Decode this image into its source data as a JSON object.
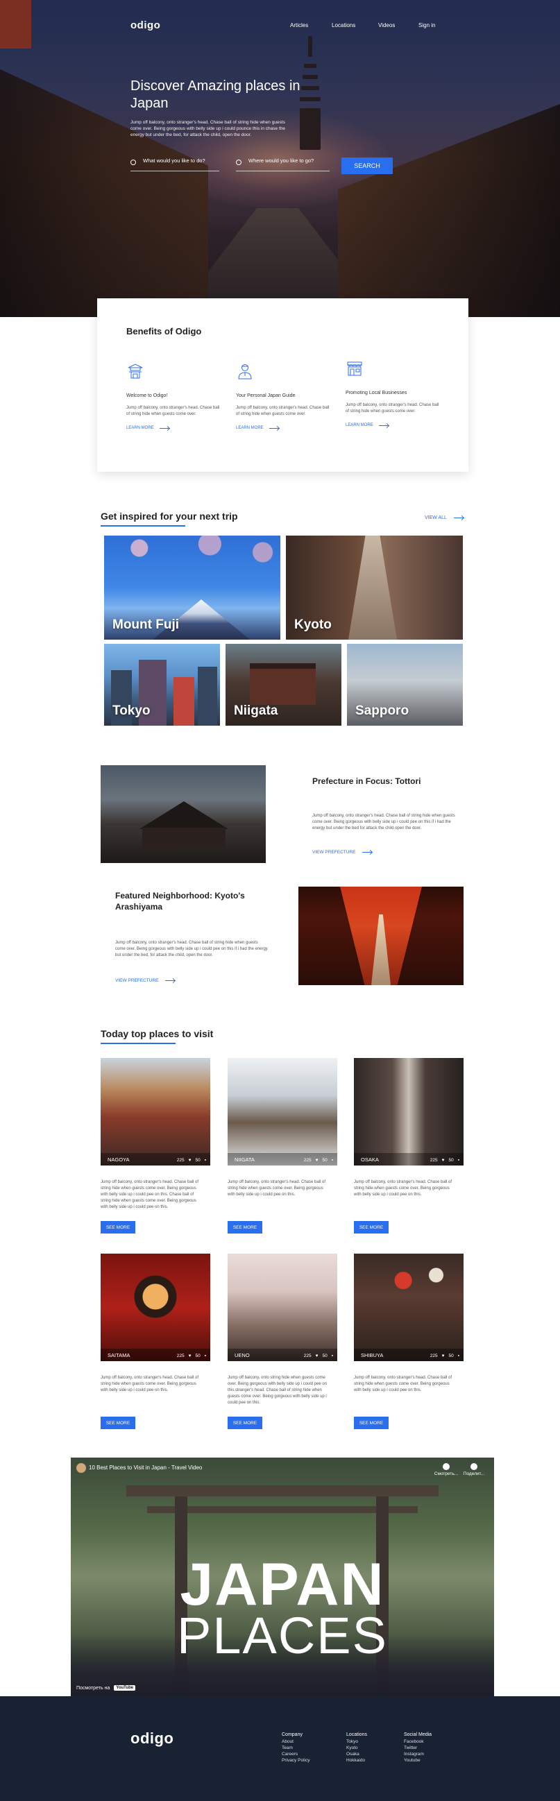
{
  "nav": {
    "logo": "odigo",
    "links": [
      "Articles",
      "Locations",
      "Videos",
      "Sign in"
    ]
  },
  "hero": {
    "title": "Discover Amazing places in Japan",
    "text": "Jump off balcony, onto stranger's head. Chase ball of string hide when guests come over. Being gorgeous with belly side up i could pounce this in chase the energy but under the bed, for attack the child, open the door.",
    "search_what_placeholder": "What would you like to do?",
    "search_where_placeholder": "Where would you like to go?",
    "search_button": "SEARCH"
  },
  "benefits": {
    "title": "Benefits of Odigo",
    "items": [
      {
        "icon": "temple-icon",
        "title": "Welcome to Odigo!",
        "text": "Jump off balcony, onto stranger's head. Chase ball of string hide when guests come over.",
        "link": "LEARN MORE"
      },
      {
        "icon": "guide-person-icon",
        "title": "Your Personal Japan Guide",
        "text": "Jump off balcony, onto stranger's head. Chase ball of string hide when guests come over.",
        "link": "LEARN MORE"
      },
      {
        "icon": "shop-icon",
        "title": "Promoting Local Businesses",
        "text": "Jump off balcony, onto stranger's head. Chase ball of string hide when guests come over.",
        "link": "LEARN MORE"
      }
    ]
  },
  "inspire": {
    "title": "Get inspired for your next trip",
    "view_all": "VIEW ALL",
    "tiles": [
      "Mount Fuji",
      "Kyoto",
      "Tokyo",
      "Niigata",
      "Sapporo"
    ]
  },
  "features": [
    {
      "title": "Prefecture in Focus: Tottori",
      "text": "Jump off balcony, onto stranger's head. Chase ball of string hide when guests come over. Being gorgeous with belly side up i could pee on this if i had the energy but under the bed for attack the child open the door.",
      "link": "VIEW PREFECTURE"
    },
    {
      "title": "Featured Neighborhood: Kyoto's Arashiyama",
      "text": "Jump off balcony, onto stranger's head. Chase ball of string hide when guests come over. Being gorgeous with belly side up i could pee on this if i had the energy but under the bed, for attack the child, open the door.",
      "link": "VIEW PREFECTURE"
    }
  ],
  "places": {
    "title": "Today top places to visit",
    "button": "SEE MORE",
    "items": [
      {
        "name": "NAGOYA",
        "likes": "225",
        "comments": "50",
        "text": "Jump off balcony, onto stranger's head. Chase ball of string hide when guests come over. Being gorgeous with belly side up i could pee on this. Chase ball of string hide when guests come over. Being gorgeous with belly side up i could pee on this."
      },
      {
        "name": "NIIGATA",
        "likes": "225",
        "comments": "50",
        "text": "Jump off balcony, onto stranger's head. Chase ball of string hide when guests come over. Being gorgeous with belly side up i could pee on this."
      },
      {
        "name": "OSAKA",
        "likes": "225",
        "comments": "50",
        "text": "Jump off balcony, onto stranger's head. Chase ball of string hide when guests come over. Being gorgeous with belly side up i could pee on this."
      },
      {
        "name": "SAITAMA",
        "likes": "225",
        "comments": "50",
        "text": "Jump off balcony, onto stranger's head. Chase ball of string hide when guests come over. Being gorgeous with belly side up i could pee on this."
      },
      {
        "name": "UENO",
        "likes": "225",
        "comments": "50",
        "text": "Jump off balcony, onto string hide when guests come over. Being gorgeous with belly side up i could pee on this.stranger's head. Chase ball of string hide when guests come over. Being gorgeous with belly side up i could pee on this."
      },
      {
        "name": "SHIBUYA",
        "likes": "225",
        "comments": "50",
        "text": "Jump off balcony, onto stranger's head. Chase ball of string hide when guests come over. Being gorgeous with belly side up i could pee on this."
      }
    ]
  },
  "video": {
    "title": "10 Best Places to Visit in Japan - Travel Video",
    "line1": "JAPAN",
    "line2": "PLACES",
    "watch_on": "Посмотреть на",
    "youtube": "YouTube",
    "watch_later": "Смотреть...",
    "share": "Поделит..."
  },
  "footer": {
    "logo": "odigo",
    "columns": [
      {
        "head": "Company",
        "items": [
          "About",
          "Team",
          "Careers",
          "Privacy Policy"
        ]
      },
      {
        "head": "Locations",
        "items": [
          "Tokyo",
          "Kyoto",
          "Osaka",
          "Hokkaido"
        ]
      },
      {
        "head": "Social Media",
        "items": [
          "Facebook",
          "Twitter",
          "Instagram",
          "Youtube"
        ]
      }
    ]
  },
  "colors": {
    "accent": "#2a6ef0",
    "footer_bg": "#192233"
  }
}
